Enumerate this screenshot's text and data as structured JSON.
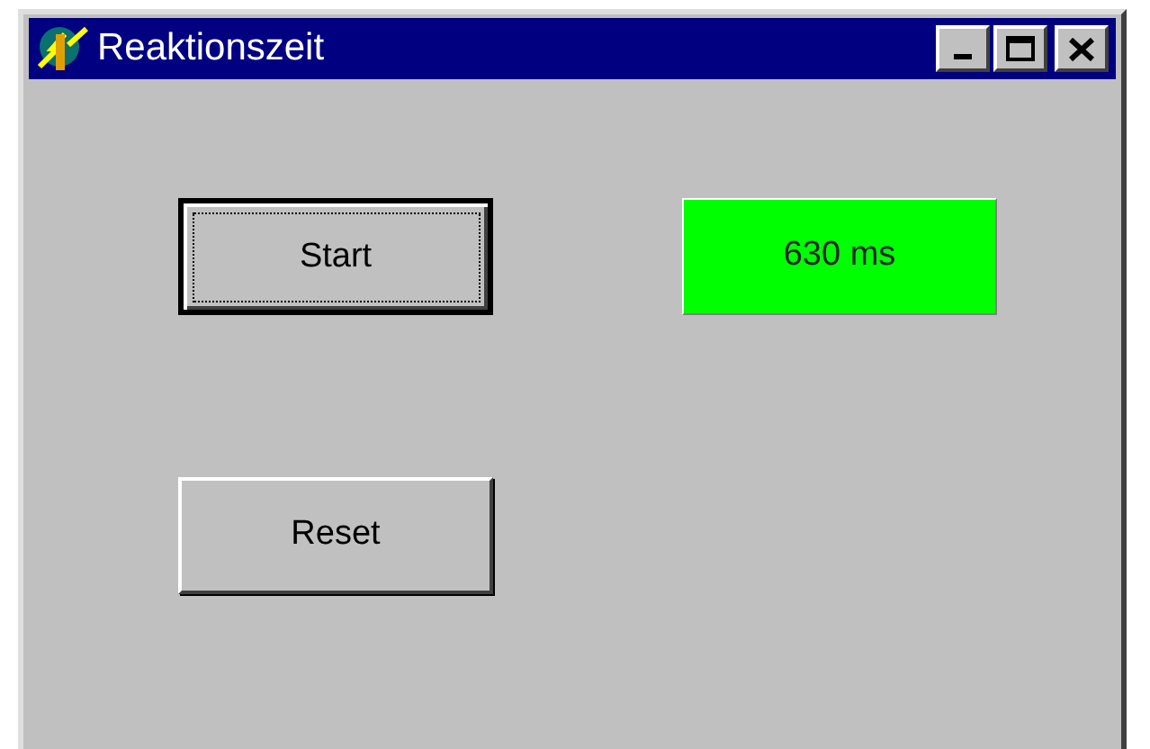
{
  "window": {
    "title": "Reaktionszeit"
  },
  "buttons": [
    {
      "label": "Start",
      "focused": true
    },
    {
      "label": "Reset",
      "focused": false
    }
  ],
  "result": {
    "text": "630 ms"
  }
}
